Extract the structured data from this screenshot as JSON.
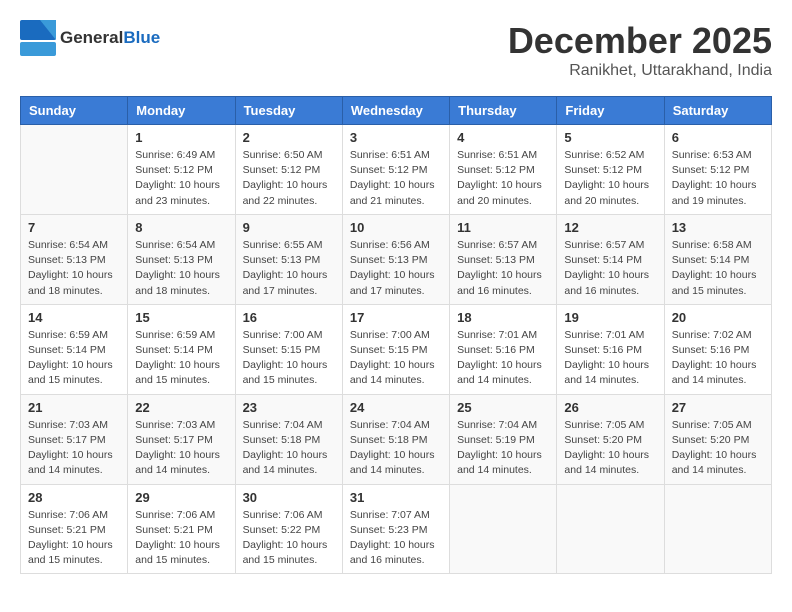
{
  "logo": {
    "text_general": "General",
    "text_blue": "Blue"
  },
  "header": {
    "month": "December 2025",
    "location": "Ranikhet, Uttarakhand, India"
  },
  "weekdays": [
    "Sunday",
    "Monday",
    "Tuesday",
    "Wednesday",
    "Thursday",
    "Friday",
    "Saturday"
  ],
  "weeks": [
    [
      {
        "day": "",
        "sunrise": "",
        "sunset": "",
        "daylight": ""
      },
      {
        "day": "1",
        "sunrise": "Sunrise: 6:49 AM",
        "sunset": "Sunset: 5:12 PM",
        "daylight": "Daylight: 10 hours and 23 minutes."
      },
      {
        "day": "2",
        "sunrise": "Sunrise: 6:50 AM",
        "sunset": "Sunset: 5:12 PM",
        "daylight": "Daylight: 10 hours and 22 minutes."
      },
      {
        "day": "3",
        "sunrise": "Sunrise: 6:51 AM",
        "sunset": "Sunset: 5:12 PM",
        "daylight": "Daylight: 10 hours and 21 minutes."
      },
      {
        "day": "4",
        "sunrise": "Sunrise: 6:51 AM",
        "sunset": "Sunset: 5:12 PM",
        "daylight": "Daylight: 10 hours and 20 minutes."
      },
      {
        "day": "5",
        "sunrise": "Sunrise: 6:52 AM",
        "sunset": "Sunset: 5:12 PM",
        "daylight": "Daylight: 10 hours and 20 minutes."
      },
      {
        "day": "6",
        "sunrise": "Sunrise: 6:53 AM",
        "sunset": "Sunset: 5:12 PM",
        "daylight": "Daylight: 10 hours and 19 minutes."
      }
    ],
    [
      {
        "day": "7",
        "sunrise": "Sunrise: 6:54 AM",
        "sunset": "Sunset: 5:13 PM",
        "daylight": "Daylight: 10 hours and 18 minutes."
      },
      {
        "day": "8",
        "sunrise": "Sunrise: 6:54 AM",
        "sunset": "Sunset: 5:13 PM",
        "daylight": "Daylight: 10 hours and 18 minutes."
      },
      {
        "day": "9",
        "sunrise": "Sunrise: 6:55 AM",
        "sunset": "Sunset: 5:13 PM",
        "daylight": "Daylight: 10 hours and 17 minutes."
      },
      {
        "day": "10",
        "sunrise": "Sunrise: 6:56 AM",
        "sunset": "Sunset: 5:13 PM",
        "daylight": "Daylight: 10 hours and 17 minutes."
      },
      {
        "day": "11",
        "sunrise": "Sunrise: 6:57 AM",
        "sunset": "Sunset: 5:13 PM",
        "daylight": "Daylight: 10 hours and 16 minutes."
      },
      {
        "day": "12",
        "sunrise": "Sunrise: 6:57 AM",
        "sunset": "Sunset: 5:14 PM",
        "daylight": "Daylight: 10 hours and 16 minutes."
      },
      {
        "day": "13",
        "sunrise": "Sunrise: 6:58 AM",
        "sunset": "Sunset: 5:14 PM",
        "daylight": "Daylight: 10 hours and 15 minutes."
      }
    ],
    [
      {
        "day": "14",
        "sunrise": "Sunrise: 6:59 AM",
        "sunset": "Sunset: 5:14 PM",
        "daylight": "Daylight: 10 hours and 15 minutes."
      },
      {
        "day": "15",
        "sunrise": "Sunrise: 6:59 AM",
        "sunset": "Sunset: 5:14 PM",
        "daylight": "Daylight: 10 hours and 15 minutes."
      },
      {
        "day": "16",
        "sunrise": "Sunrise: 7:00 AM",
        "sunset": "Sunset: 5:15 PM",
        "daylight": "Daylight: 10 hours and 15 minutes."
      },
      {
        "day": "17",
        "sunrise": "Sunrise: 7:00 AM",
        "sunset": "Sunset: 5:15 PM",
        "daylight": "Daylight: 10 hours and 14 minutes."
      },
      {
        "day": "18",
        "sunrise": "Sunrise: 7:01 AM",
        "sunset": "Sunset: 5:16 PM",
        "daylight": "Daylight: 10 hours and 14 minutes."
      },
      {
        "day": "19",
        "sunrise": "Sunrise: 7:01 AM",
        "sunset": "Sunset: 5:16 PM",
        "daylight": "Daylight: 10 hours and 14 minutes."
      },
      {
        "day": "20",
        "sunrise": "Sunrise: 7:02 AM",
        "sunset": "Sunset: 5:16 PM",
        "daylight": "Daylight: 10 hours and 14 minutes."
      }
    ],
    [
      {
        "day": "21",
        "sunrise": "Sunrise: 7:03 AM",
        "sunset": "Sunset: 5:17 PM",
        "daylight": "Daylight: 10 hours and 14 minutes."
      },
      {
        "day": "22",
        "sunrise": "Sunrise: 7:03 AM",
        "sunset": "Sunset: 5:17 PM",
        "daylight": "Daylight: 10 hours and 14 minutes."
      },
      {
        "day": "23",
        "sunrise": "Sunrise: 7:04 AM",
        "sunset": "Sunset: 5:18 PM",
        "daylight": "Daylight: 10 hours and 14 minutes."
      },
      {
        "day": "24",
        "sunrise": "Sunrise: 7:04 AM",
        "sunset": "Sunset: 5:18 PM",
        "daylight": "Daylight: 10 hours and 14 minutes."
      },
      {
        "day": "25",
        "sunrise": "Sunrise: 7:04 AM",
        "sunset": "Sunset: 5:19 PM",
        "daylight": "Daylight: 10 hours and 14 minutes."
      },
      {
        "day": "26",
        "sunrise": "Sunrise: 7:05 AM",
        "sunset": "Sunset: 5:20 PM",
        "daylight": "Daylight: 10 hours and 14 minutes."
      },
      {
        "day": "27",
        "sunrise": "Sunrise: 7:05 AM",
        "sunset": "Sunset: 5:20 PM",
        "daylight": "Daylight: 10 hours and 14 minutes."
      }
    ],
    [
      {
        "day": "28",
        "sunrise": "Sunrise: 7:06 AM",
        "sunset": "Sunset: 5:21 PM",
        "daylight": "Daylight: 10 hours and 15 minutes."
      },
      {
        "day": "29",
        "sunrise": "Sunrise: 7:06 AM",
        "sunset": "Sunset: 5:21 PM",
        "daylight": "Daylight: 10 hours and 15 minutes."
      },
      {
        "day": "30",
        "sunrise": "Sunrise: 7:06 AM",
        "sunset": "Sunset: 5:22 PM",
        "daylight": "Daylight: 10 hours and 15 minutes."
      },
      {
        "day": "31",
        "sunrise": "Sunrise: 7:07 AM",
        "sunset": "Sunset: 5:23 PM",
        "daylight": "Daylight: 10 hours and 16 minutes."
      },
      {
        "day": "",
        "sunrise": "",
        "sunset": "",
        "daylight": ""
      },
      {
        "day": "",
        "sunrise": "",
        "sunset": "",
        "daylight": ""
      },
      {
        "day": "",
        "sunrise": "",
        "sunset": "",
        "daylight": ""
      }
    ]
  ]
}
